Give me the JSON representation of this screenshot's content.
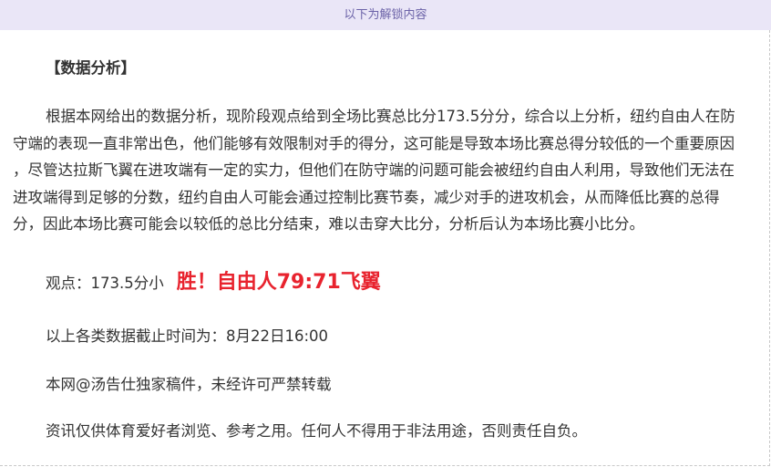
{
  "banner": {
    "text": "以下为解锁内容"
  },
  "article": {
    "section_title": "【数据分析】",
    "analysis": "根据本网给出的数据分析，现阶段观点给到全场比赛总比分173.5分分，综合以上分析，纽约自由人在防守端的表现一直非常出色，他们能够有效限制对手的得分，这可能是导致本场比赛总得分较低的一个重要原因 ，尽管达拉斯飞翼在进攻端有一定的实力，但他们在防守端的问题可能会被纽约自由人利用，导致他们无法在进攻端得到足够的分数，纽约自由人可能会通过控制比赛节奏，减少对手的进攻机会，从而降低比赛的总得分，因此本场比赛可能会以较低的总比分结束，难以击穿大比分，分析后认为本场比赛小比分。",
    "opinion_label": "观点：173.5分小",
    "result": "胜！自由人79:71飞翼",
    "cutoff_time": "以上各类数据截止时间为：8月22日16:00",
    "copyright": "本网@汤告仕独家稿件，未经许可严禁转载",
    "disclaimer": "资讯仅供体育爱好者浏览、参考之用。任何人不得用于非法用途，否则责任自负。"
  },
  "colors": {
    "banner_bg": "#eae6f7",
    "banner_text": "#6c63a8",
    "result_red": "#e8232e",
    "body_text": "#333333"
  }
}
